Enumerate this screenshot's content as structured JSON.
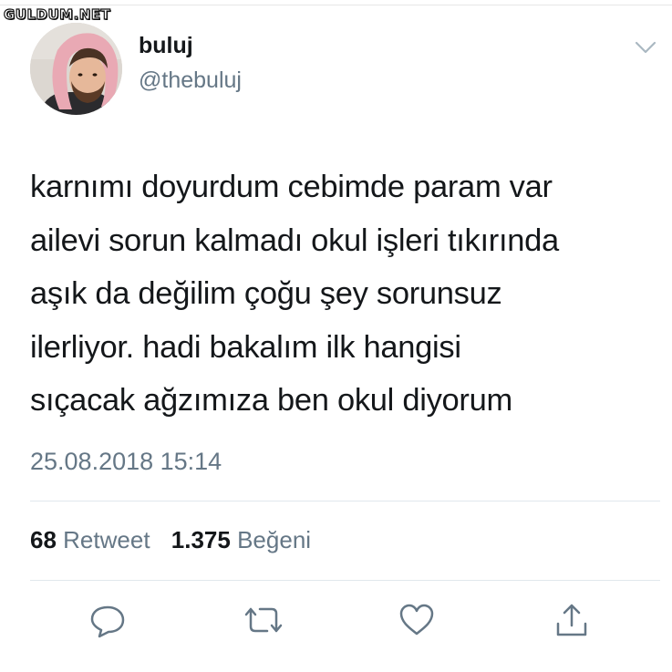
{
  "watermark": {
    "text": "GULDUM.NET"
  },
  "tweet": {
    "author": {
      "name": "buluj",
      "handle": "@thebuluj"
    },
    "text_lines": [
      "karnımı doyurdum cebimde param var",
      "ailevi sorun kalmadı okul işleri tıkırında",
      "aşık da değilim çoğu şey sorunsuz",
      "ilerliyor. hadi bakalım ilk hangisi",
      "sıçacak ağzımıza ben okul diyorum"
    ],
    "timestamp": "25.08.2018 15:14",
    "stats": {
      "retweet_count": "68",
      "retweet_label": "Retweet",
      "like_count": "1.375",
      "like_label": "Beğeni"
    }
  },
  "icons": {
    "menu": "chevron-down-icon",
    "reply": "reply-icon",
    "retweet": "retweet-icon",
    "like": "heart-icon",
    "share": "share-icon"
  },
  "colors": {
    "primary_text": "#14171a",
    "secondary_text": "#657786",
    "divider": "#e1e8ed",
    "icon": "#657786"
  }
}
